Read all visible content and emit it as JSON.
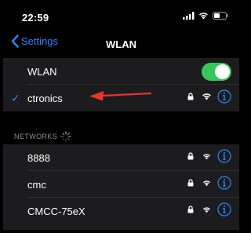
{
  "status": {
    "time": "22:59"
  },
  "nav": {
    "back_label": "Settings",
    "title": "WLAN"
  },
  "wlan_toggle": {
    "label": "WLAN",
    "on": true
  },
  "connected": {
    "name": "ctronics",
    "secured": true
  },
  "networks_header": "NETWORKS",
  "networks": [
    {
      "name": "8888",
      "secured": true
    },
    {
      "name": "cmc",
      "secured": true
    },
    {
      "name": "CMCC-75eX",
      "secured": true
    }
  ],
  "colors": {
    "accent": "#2b86ff",
    "toggle_on": "#34c759",
    "annotation_arrow": "#e8322a"
  },
  "icons": [
    "chevron-left-icon",
    "signal-icon",
    "wifi-icon",
    "battery-icon",
    "checkmark-icon",
    "lock-icon",
    "info-icon",
    "spinner-icon"
  ]
}
